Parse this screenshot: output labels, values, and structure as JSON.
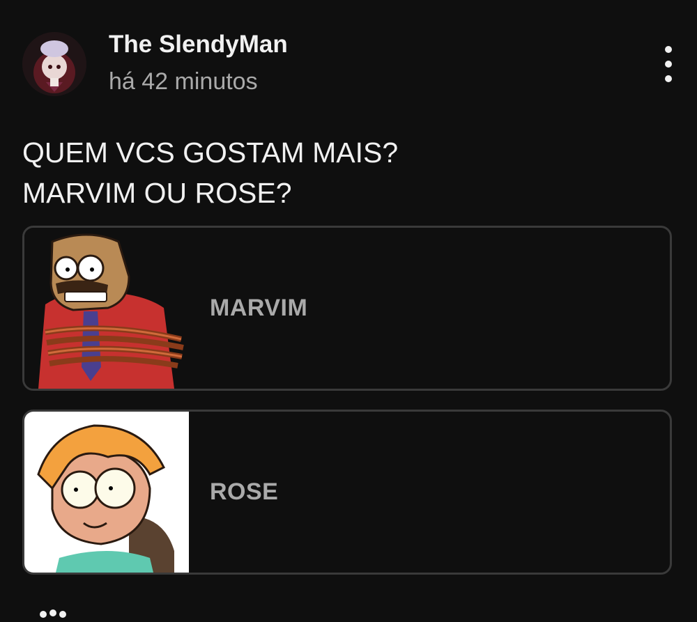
{
  "post": {
    "author": "The SlendyMan",
    "time": "há 42 minutos",
    "text_line1": "QUEM VCS GOSTAM MAIS?",
    "text_line2": "MARVIM OU ROSE?"
  },
  "poll": {
    "options": [
      {
        "label": "MARVIM"
      },
      {
        "label": "ROSE"
      }
    ]
  },
  "icons": {
    "menu": "more-vert-icon"
  },
  "colors": {
    "background": "#0f0f0f",
    "option_border": "#3a3a3a",
    "primary_text": "#f1f1f1",
    "secondary_text": "#aaaaaa"
  }
}
